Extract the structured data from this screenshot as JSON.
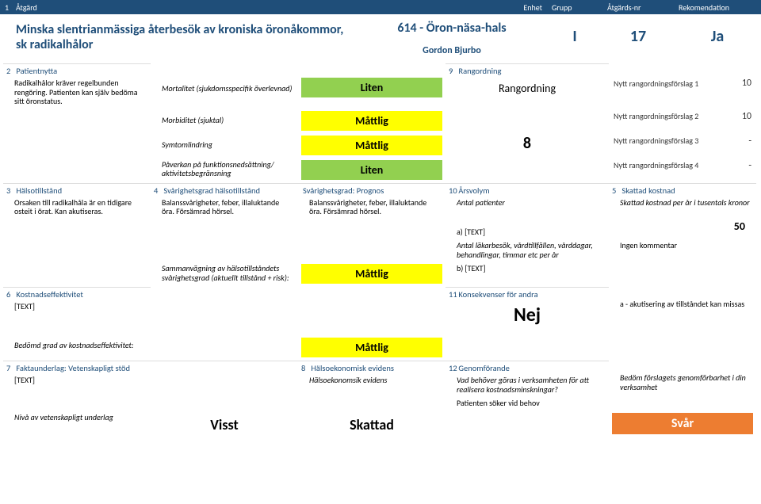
{
  "topbar": {
    "num": "1",
    "act": "Åtgärd",
    "enh": "Enhet",
    "grp": "Grupp",
    "anr": "Åtgärds-nr",
    "rek": "Rekomendation"
  },
  "title": {
    "main": "Minska slentrianmässiga återbesök av kroniska öronåkommor, sk radikalhålor",
    "unit": "614 - Öron-näsa-hals",
    "who": "Gordon Bjurbo",
    "grp": "I",
    "anr": "17",
    "rek": "Ja"
  },
  "s2": {
    "hdr": "Patientnytta",
    "n": "2",
    "body": "Radikalhålor kräver regelbunden rengöring. Patienten kan själv bedöma sitt öronstatus.",
    "rows": [
      {
        "label": "Mortalitet (sjukdomsspecifik överlevnad)",
        "val": "Liten",
        "cls": "v-green"
      },
      {
        "label": "Morbiditet (sjuktal)",
        "val": "Måttlig",
        "cls": "v-yellow"
      },
      {
        "label": "Symtomlindring",
        "val": "Måttlig",
        "cls": "v-yellow"
      },
      {
        "label": "Påverkan på funktionsnedsättning/ aktivitetsbegränsning",
        "val": "Liten",
        "cls": "v-green"
      }
    ]
  },
  "s9": {
    "hdr": "Rangordning",
    "n": "9",
    "label": "Rangordning",
    "big": "8",
    "rows": [
      {
        "label": "Nytt rangordningsförslag 1",
        "val": "10"
      },
      {
        "label": "Nytt rangordningsförslag 2",
        "val": "10"
      },
      {
        "label": "Nytt rangordningsförslag 3",
        "val": "-"
      },
      {
        "label": "Nytt rangordningsförslag 4",
        "val": "-"
      }
    ]
  },
  "s3": {
    "hdr": "Hälsotillstånd",
    "n": "3",
    "body": "Orsaken till radikalhåla är en tidigare osteit i örat. Kan akutiseras."
  },
  "s4": {
    "hdr": "Svårighetsgrad hälsotillstånd",
    "n": "4",
    "body": "Balanssvårigheter, feber, illaluktande öra. Försämrad hörsel.",
    "sum_label": "Sammanvägning av hälsotillståndets svårighetsgrad (aktuellt tillstånd + risk):",
    "sum_val": "Måttlig"
  },
  "prognos": {
    "hdr": "Svårighetsgrad: Prognos",
    "body": "Balanssvårigheter, feber, illaluktande öra. Försämrad hörsel."
  },
  "s10": {
    "hdr": "Årsvolym",
    "n": "10",
    "antal_pat": "Antal patienter",
    "a_label": "a) [TEXT]",
    "b_label_long": "Antal läkarbesök, vårdtillfällen, vårddagar, behandlingar, timmar etc per år",
    "b_label": "b) [TEXT]"
  },
  "s5": {
    "hdr": "Skattad kostnad",
    "n": "5",
    "sub": "Skattad kostnad per år i tusentals kronor",
    "a_val": "50",
    "ingen": "Ingen kommentar"
  },
  "s6": {
    "hdr": "Kostnadseffektivitet",
    "n": "6",
    "body": "[TEXT]",
    "bed": "Bedömd grad av kostnadseffektivitet:",
    "val": "Måttlig"
  },
  "s11": {
    "hdr": "Konsekvenser för andra",
    "n": "11",
    "nej": "Nej",
    "txt": "a - akutisering av tillståndet kan missas"
  },
  "s7": {
    "hdr": "Faktaunderlag: Vetenskapligt stöd",
    "n": "7",
    "body": "[TEXT]",
    "niv": "Nivå av vetenskapligt underlag",
    "val": "Visst"
  },
  "s8": {
    "hdr": "Hälsoekonomisk evidens",
    "n": "8",
    "sub": "Hälsoekonomsik evidens",
    "val": "Skattad"
  },
  "s12": {
    "hdr": "Genomförande",
    "n": "12",
    "q": "Vad behöver göras i verksamheten för att realisera kostnadsminskningar?",
    "a": "Patienten söker vid behov",
    "bed": "Bedöm förslagets genomförbarhet i din verksamhet",
    "val": "Svår"
  }
}
